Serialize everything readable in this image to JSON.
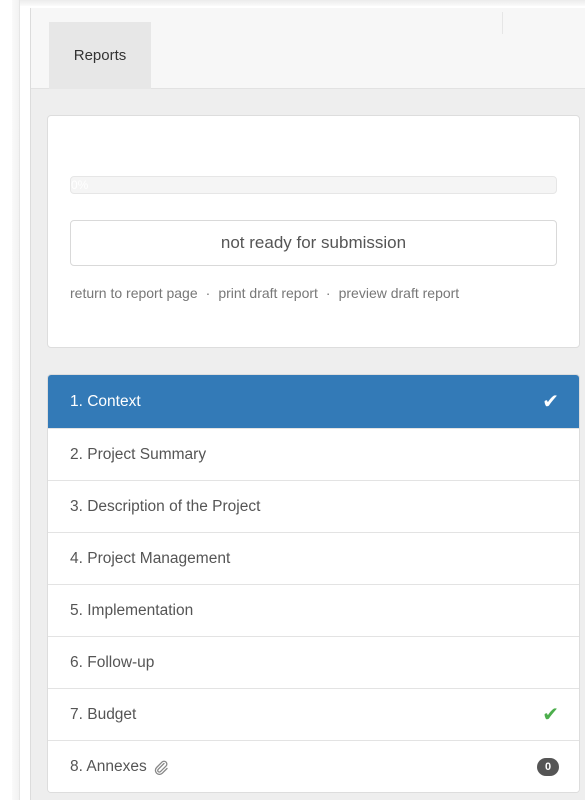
{
  "tabs": [
    {
      "label": "Reports"
    }
  ],
  "progress": {
    "percent": 0,
    "label": "0%"
  },
  "status_label": "not ready for submission",
  "links": {
    "return": "return to report page",
    "print": "print draft report",
    "preview": "preview draft report",
    "separator": "·"
  },
  "sections": [
    {
      "label": "1. Context",
      "active": true,
      "complete": true
    },
    {
      "label": "2. Project Summary",
      "active": false,
      "complete": false
    },
    {
      "label": "3. Description of the Project",
      "active": false,
      "complete": false
    },
    {
      "label": "4. Project Management",
      "active": false,
      "complete": false
    },
    {
      "label": "5. Implementation",
      "active": false,
      "complete": false
    },
    {
      "label": "6. Follow-up",
      "active": false,
      "complete": false
    },
    {
      "label": "7. Budget",
      "active": false,
      "complete": true
    },
    {
      "label": "8. Annexes",
      "active": false,
      "complete": false,
      "icon": "paperclip-icon",
      "badge": "0"
    }
  ],
  "colors": {
    "active": "#337ab7",
    "complete": "#4cae4c",
    "badge": "#555555"
  }
}
